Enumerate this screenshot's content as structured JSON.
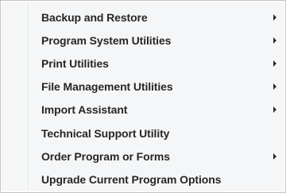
{
  "menu": {
    "items": [
      {
        "label": "Backup and Restore",
        "submenu": true,
        "arrow_icon": "chevron-right-icon"
      },
      {
        "label": "Program System Utilities",
        "submenu": true,
        "arrow_icon": "chevron-right-icon"
      },
      {
        "label": "Print Utilities",
        "submenu": true,
        "arrow_icon": "chevron-right-icon"
      },
      {
        "label": "File Management Utilities",
        "submenu": true,
        "arrow_icon": "chevron-right-icon"
      },
      {
        "label": "Import Assistant",
        "submenu": true,
        "arrow_icon": "chevron-right-icon"
      },
      {
        "label": "Technical Support Utility",
        "submenu": false
      },
      {
        "label": "Order Program or Forms",
        "submenu": true,
        "arrow_icon": "chevron-right-icon"
      },
      {
        "label": "Upgrade Current Program Options",
        "submenu": false
      }
    ]
  },
  "colors": {
    "menu_background": "#f5f6f7",
    "menu_border": "#c4c4c4",
    "text": "#262626"
  }
}
